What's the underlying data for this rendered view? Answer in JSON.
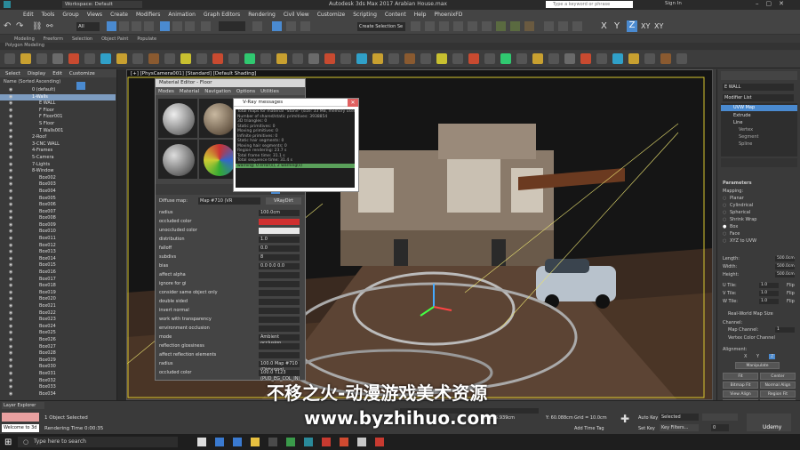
{
  "window": {
    "title": "Autodesk 3ds Max 2017    Arabian House.max",
    "workspace": "Workspace: Default",
    "search_placeholder": "Type a keyword or phrase",
    "sign_in": "Sign In"
  },
  "menu": [
    "Edit",
    "Tools",
    "Group",
    "Views",
    "Create",
    "Modifiers",
    "Animation",
    "Graph Editors",
    "Rendering",
    "Civil View",
    "Customize",
    "Scripting",
    "Content",
    "Help",
    "PhoenixFD"
  ],
  "toolbar": {
    "view_dropdown": "All",
    "selection_set": "Create Selection Se",
    "axes": [
      "X",
      "Y",
      "Z",
      "XY",
      "XY"
    ]
  },
  "ribbon": {
    "tabs": [
      "Modeling",
      "Freeform",
      "Selection",
      "Object Paint",
      "Populate"
    ],
    "sub": "Polygon Modeling"
  },
  "scene_explorer": {
    "menus": [
      "Select",
      "Display",
      "Edit",
      "Customize"
    ],
    "header": "Name (Sorted Ascending)",
    "items": [
      {
        "label": "0 (default)",
        "sel": false,
        "indent": false
      },
      {
        "label": "1-Walls",
        "sel": true,
        "indent": false
      },
      {
        "label": "E WALL",
        "sel": false,
        "indent": true
      },
      {
        "label": "F Floor",
        "sel": false,
        "indent": true
      },
      {
        "label": "F Floor001",
        "sel": false,
        "indent": true
      },
      {
        "label": "S Floor",
        "sel": false,
        "indent": true
      },
      {
        "label": "T Walls001",
        "sel": false,
        "indent": true
      },
      {
        "label": "2-Roof",
        "sel": false,
        "indent": false
      },
      {
        "label": "3-CNC WALL",
        "sel": false,
        "indent": false
      },
      {
        "label": "4-Frames",
        "sel": false,
        "indent": false
      },
      {
        "label": "5-Camera",
        "sel": false,
        "indent": false
      },
      {
        "label": "7-Lights",
        "sel": false,
        "indent": false
      },
      {
        "label": "8-Window",
        "sel": false,
        "indent": false
      },
      {
        "label": "Box002",
        "sel": false,
        "indent": true
      },
      {
        "label": "Box003",
        "sel": false,
        "indent": true
      },
      {
        "label": "Box004",
        "sel": false,
        "indent": true
      },
      {
        "label": "Box005",
        "sel": false,
        "indent": true
      },
      {
        "label": "Box006",
        "sel": false,
        "indent": true
      },
      {
        "label": "Box007",
        "sel": false,
        "indent": true
      },
      {
        "label": "Box008",
        "sel": false,
        "indent": true
      },
      {
        "label": "Box009",
        "sel": false,
        "indent": true
      },
      {
        "label": "Box010",
        "sel": false,
        "indent": true
      },
      {
        "label": "Box011",
        "sel": false,
        "indent": true
      },
      {
        "label": "Box012",
        "sel": false,
        "indent": true
      },
      {
        "label": "Box013",
        "sel": false,
        "indent": true
      },
      {
        "label": "Box014",
        "sel": false,
        "indent": true
      },
      {
        "label": "Box015",
        "sel": false,
        "indent": true
      },
      {
        "label": "Box016",
        "sel": false,
        "indent": true
      },
      {
        "label": "Box017",
        "sel": false,
        "indent": true
      },
      {
        "label": "Box018",
        "sel": false,
        "indent": true
      },
      {
        "label": "Box019",
        "sel": false,
        "indent": true
      },
      {
        "label": "Box020",
        "sel": false,
        "indent": true
      },
      {
        "label": "Box021",
        "sel": false,
        "indent": true
      },
      {
        "label": "Box022",
        "sel": false,
        "indent": true
      },
      {
        "label": "Box023",
        "sel": false,
        "indent": true
      },
      {
        "label": "Box024",
        "sel": false,
        "indent": true
      },
      {
        "label": "Box025",
        "sel": false,
        "indent": true
      },
      {
        "label": "Box026",
        "sel": false,
        "indent": true
      },
      {
        "label": "Box027",
        "sel": false,
        "indent": true
      },
      {
        "label": "Box028",
        "sel": false,
        "indent": true
      },
      {
        "label": "Box029",
        "sel": false,
        "indent": true
      },
      {
        "label": "Box030",
        "sel": false,
        "indent": true
      },
      {
        "label": "Box031",
        "sel": false,
        "indent": true
      },
      {
        "label": "Box032",
        "sel": false,
        "indent": true
      },
      {
        "label": "Box033",
        "sel": false,
        "indent": true
      },
      {
        "label": "Box034",
        "sel": false,
        "indent": true
      }
    ],
    "footer": "Layer Explorer"
  },
  "viewport": {
    "label": "[+] [PhysCamera001] [Standard] [Default Shading]"
  },
  "material_editor": {
    "title": "Material Editor - Floor",
    "menus": [
      "Modes",
      "Material",
      "Navigation",
      "Options",
      "Utilities"
    ],
    "diffuse_label": "Diffuse map:",
    "diffuse_map": "Map #710 (VR",
    "map_type": "VRayDirt",
    "params": [
      {
        "label": "radius",
        "value": "100.0cm"
      },
      {
        "label": "occluded color",
        "value": ""
      },
      {
        "label": "unoccluded color",
        "value": ""
      },
      {
        "label": "distribution",
        "value": "1.0"
      },
      {
        "label": "falloff",
        "value": "0.0"
      },
      {
        "label": "subdivs",
        "value": "8"
      },
      {
        "label": "bias",
        "value": "0.0    0.0    0.0"
      },
      {
        "label": "affect alpha",
        "value": ""
      },
      {
        "label": "ignore for gi",
        "value": ""
      },
      {
        "label": "consider same object only",
        "value": ""
      },
      {
        "label": "double sided",
        "value": ""
      },
      {
        "label": "invert normal",
        "value": ""
      },
      {
        "label": "work with transparency",
        "value": ""
      },
      {
        "label": "environment occlusion",
        "value": ""
      },
      {
        "label": "mode",
        "value": "Ambient occlusion"
      },
      {
        "label": "reflection glossiness",
        "value": ""
      },
      {
        "label": "affect reflection elements",
        "value": ""
      },
      {
        "label": "radius",
        "value": "100.0   Map #710 (Dirty.png)"
      },
      {
        "label": "occluded color",
        "value": "100.0   T123 (PUD_EG_COL_IN)"
      }
    ]
  },
  "vray_messages": {
    "title": "V-Ray messages",
    "lines": [
      "Total maps for material \"Stone\" (size: 33 MB, memory used)",
      "Number of shared/static primitives: 3938854",
      "3D triangles: 0",
      "Static primitives: 0",
      "Moving primitives: 0",
      "Infinite primitives: 0",
      "Static hair segments: 0",
      "Moving hair segments: 0",
      "Region rendering: 23.7 s",
      "Total frame time: 31.1 s",
      "Total sequence time: 31.4 s",
      "warning: 0 error(s), 2 warning(s)"
    ]
  },
  "command_panel": {
    "object": "E WALL",
    "modifier_list": "Modifier List",
    "stack": [
      "UVW Map",
      "Extrude",
      "Line",
      "Vertex",
      "Segment",
      "Spline"
    ],
    "section": "Parameters",
    "mapping_label": "Mapping:",
    "mapping": [
      "Planar",
      "Cylindrical",
      "Spherical",
      "Shrink Wrap",
      "Box",
      "Face",
      "XYZ to UVW"
    ],
    "length": "500.0cm",
    "width": "500.0cm",
    "height": "500.0cm",
    "utile": "1.0",
    "vtile": "1.0",
    "wtile": "1.0",
    "flip": "Flip",
    "real_world": "Real-World Map Size",
    "channel_label": "Channel:",
    "map_channel": "Map Channel:",
    "map_channel_value": "1",
    "vertex_color": "Vertex Color Channel",
    "alignment_label": "Alignment:",
    "align_axes": [
      "X",
      "Y",
      "Z"
    ],
    "manipulate": "Manipulate",
    "align_buttons": [
      "Fit",
      "Center",
      "Bitmap Fit",
      "Normal Align",
      "View Align",
      "Region Fit",
      "Reset",
      "Acquire"
    ]
  },
  "status": {
    "selected": "1 Object Selected",
    "render_time": "Rendering Time 0:00:35",
    "x": "X: 815.939cm",
    "y": "Y: 60.088cm",
    "grid": "Grid = 10.0cm",
    "add_time_tag": "Add Time Tag",
    "autokey": "Auto Key",
    "selected_dd": "Selected",
    "setkey": "Set Key",
    "keyfilters": "Key Filters...",
    "frame": "0",
    "welcome": "Welcome to 3d",
    "layer_explorer": "Layer Explorer"
  },
  "taskbar": {
    "search": "Type here to search"
  },
  "watermark": {
    "cn": "不移之火-动漫游戏美术资源",
    "url": "www.byzhihuo.com",
    "udemy": "Udemy"
  }
}
